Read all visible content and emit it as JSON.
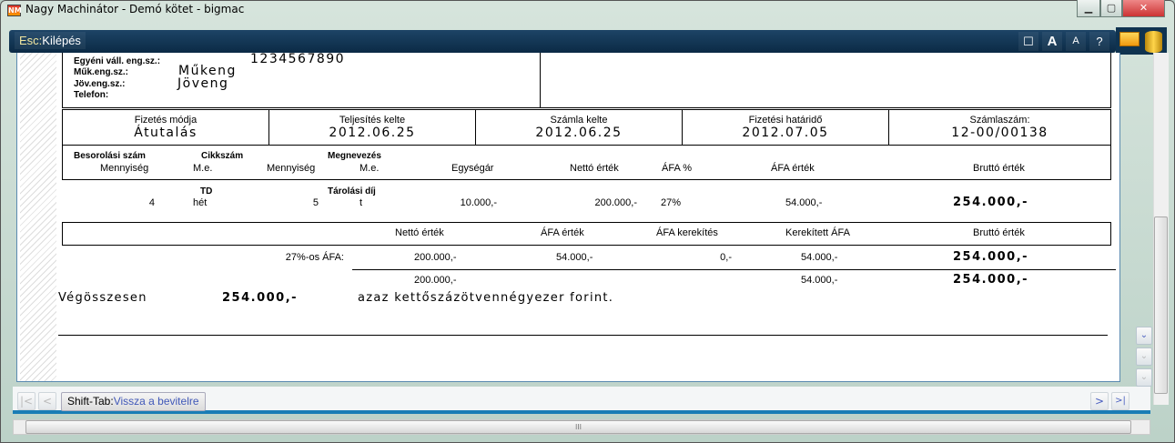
{
  "window": {
    "title": "Nagy Machinátor - Demó kötet - bigmac",
    "app_icon": "NM",
    "minimize": "▁",
    "maximize": "▢",
    "close": "✕"
  },
  "toolbar": {
    "esc_key": "Esc:",
    "esc_label": "Kilépés",
    "buttons": [
      "☐",
      "A",
      "A",
      "?"
    ]
  },
  "seller": {
    "rows": [
      {
        "label": "Egyéni váll. eng.sz.:",
        "value": "1234567890"
      },
      {
        "label": "Műk.eng.sz.:",
        "value": "Műkeng"
      },
      {
        "label": "Jöv.eng.sz.:",
        "value": "Jöveng"
      },
      {
        "label": "Telefon:",
        "value": ""
      }
    ]
  },
  "payment": [
    {
      "label": "Fizetés módja",
      "value": "Átutalás"
    },
    {
      "label": "Teljesítés kelte",
      "value": "2012.06.25"
    },
    {
      "label": "Számla kelte",
      "value": "2012.06.25"
    },
    {
      "label": "Fizetési határidő",
      "value": "2012.07.05"
    },
    {
      "label": "Számlaszám:",
      "value": "12-00/00138"
    }
  ],
  "items_header": {
    "besorolasi": "Besorolási szám",
    "cikkszam": "Cikkszám",
    "megnevezes": "Megnevezés",
    "mennyiseg1": "Mennyiség",
    "me1": "M.e.",
    "mennyiseg2": "Mennyiség",
    "me2": "M.e.",
    "egysegar": "Egységár",
    "netto": "Nettó érték",
    "afa_pct": "ÁFA %",
    "afa_ertek": "ÁFA érték",
    "brutto": "Bruttó érték"
  },
  "items": [
    {
      "cikkszam": "TD",
      "megnevezes": "Tárolási díj",
      "mennyiseg1": "4",
      "me1": "hét",
      "mennyiseg2": "5",
      "me2": "t",
      "egysegar": "10.000,-",
      "netto": "200.000,-",
      "afa_pct": "27%",
      "afa_ertek": "54.000,-",
      "brutto": "254.000,-"
    }
  ],
  "summary_header": {
    "netto": "Nettó érték",
    "afa_ertek": "ÁFA érték",
    "afa_kerekites": "ÁFA kerekítés",
    "kerekitett_afa": "Kerekített ÁFA",
    "brutto": "Bruttó érték"
  },
  "summary_rows": [
    {
      "label": "27%-os ÁFA:",
      "netto": "200.000,-",
      "afa_ertek": "54.000,-",
      "afa_kerekites": "0,-",
      "kerekitett_afa": "54.000,-",
      "brutto": "254.000,-"
    }
  ],
  "summary_total": {
    "netto": "200.000,-",
    "kerekitett_afa": "54.000,-",
    "brutto": "254.000,-"
  },
  "grand_total": {
    "label": "Végösszesen",
    "value": "254.000,-",
    "in_words": "azaz kettőszázötvennégyezer forint."
  },
  "bottom": {
    "shift_key": "Shift-Tab:",
    "shift_label": "Vissza a bevitelre",
    "first": "|<",
    "prev": "<",
    "next": ">",
    "last": ">|",
    "grip": "III"
  }
}
